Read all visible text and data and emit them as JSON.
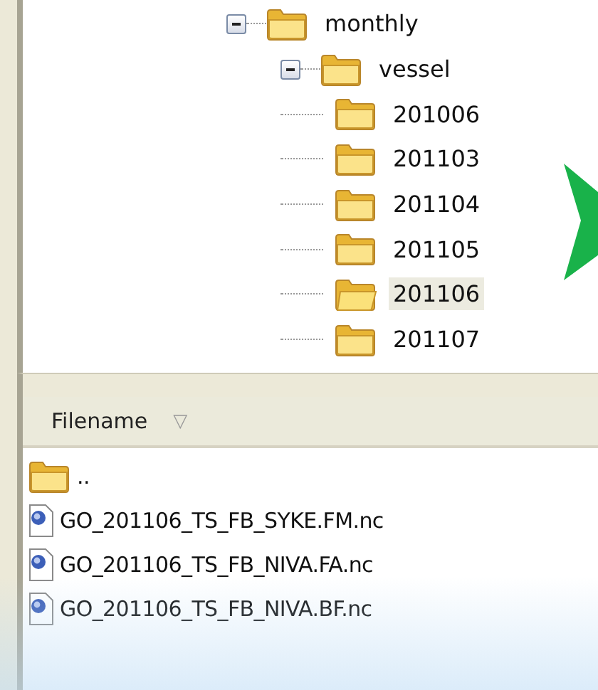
{
  "tree": [
    {
      "label": "monthly",
      "expanded": true,
      "selected": false,
      "children": [
        {
          "label": "vessel",
          "expanded": true,
          "selected": false,
          "children": [
            {
              "label": "201006",
              "selected": false
            },
            {
              "label": "201103",
              "selected": false
            },
            {
              "label": "201104",
              "selected": false
            },
            {
              "label": "201105",
              "selected": false
            },
            {
              "label": "201106",
              "selected": true
            },
            {
              "label": "201107",
              "selected": false
            }
          ]
        }
      ]
    }
  ],
  "file_list": {
    "column": "Filename",
    "sort_icon": "▽",
    "rows": [
      {
        "kind": "folder",
        "name": ".."
      },
      {
        "kind": "file",
        "name": "GO_201106_TS_FB_SYKE.FM.nc"
      },
      {
        "kind": "file",
        "name": "GO_201106_TS_FB_NIVA.FA.nc"
      },
      {
        "kind": "file",
        "name": "GO_201106_TS_FB_NIVA.BF.nc"
      }
    ]
  }
}
